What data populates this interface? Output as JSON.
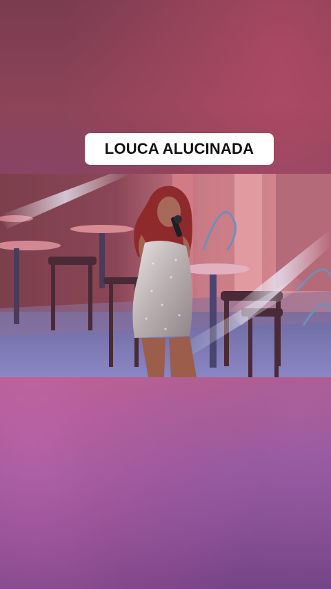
{
  "caption": {
    "text": "LOUCA ALUCINADA"
  },
  "colors": {
    "caption_bg": "#ffffff",
    "caption_text": "#111111",
    "stage_floor": "#7d6fa3",
    "stage_wall": "#b46a7e",
    "dress": "#c9c2c4",
    "hair": "#8e2a2c",
    "skin": "#a86a55"
  },
  "video": {
    "icon": "performer-video-frame"
  }
}
